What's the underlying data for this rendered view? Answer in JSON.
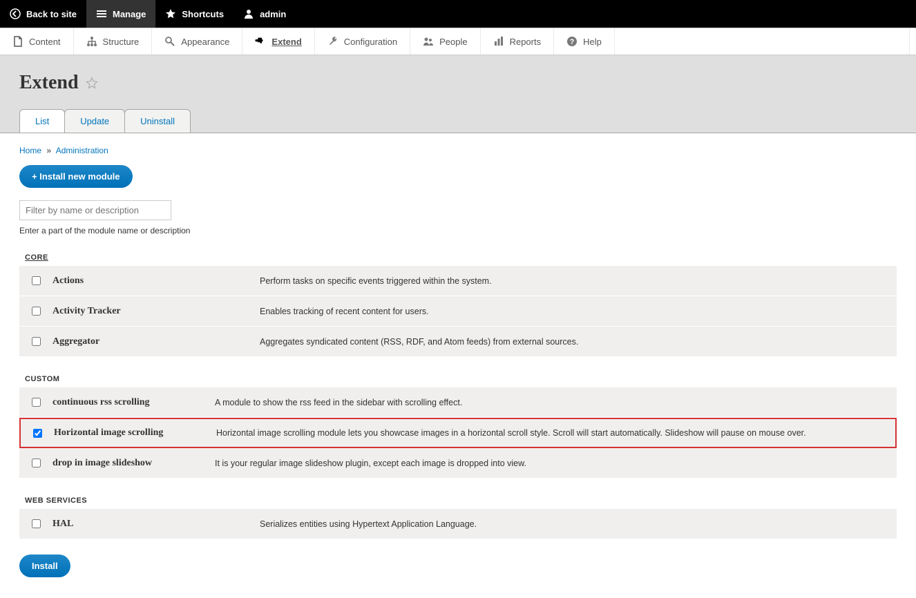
{
  "toolbar_black": {
    "back": "Back to site",
    "manage": "Manage",
    "shortcuts": "Shortcuts",
    "admin": "admin"
  },
  "toolbar_white": {
    "content": "Content",
    "structure": "Structure",
    "appearance": "Appearance",
    "extend": "Extend",
    "configuration": "Configuration",
    "people": "People",
    "reports": "Reports",
    "help": "Help"
  },
  "page": {
    "title": "Extend"
  },
  "tabs": {
    "list": "List",
    "update": "Update",
    "uninstall": "Uninstall"
  },
  "breadcrumb": {
    "home": "Home",
    "administration": "Administration"
  },
  "buttons": {
    "install_new": "+ Install new module",
    "install": "Install"
  },
  "filter": {
    "placeholder": "Filter by name or description",
    "help": "Enter a part of the module name or description"
  },
  "groups": {
    "core": "CORE",
    "custom": "CUSTOM",
    "web_services": "WEB SERVICES"
  },
  "modules": {
    "core": [
      {
        "name": "Actions",
        "desc": "Perform tasks on specific events triggered within the system."
      },
      {
        "name": "Activity Tracker",
        "desc": "Enables tracking of recent content for users."
      },
      {
        "name": "Aggregator",
        "desc": "Aggregates syndicated content (RSS, RDF, and Atom feeds) from external sources."
      }
    ],
    "custom": [
      {
        "name": "continuous rss scrolling",
        "desc": "A module to show the rss feed in the sidebar with scrolling effect."
      },
      {
        "name": "Horizontal image scrolling",
        "desc": "Horizontal image scrolling module lets you showcase images in a horizontal scroll style. Scroll will start automatically. Slideshow will pause on mouse over.",
        "checked": true,
        "highlight": true
      },
      {
        "name": "drop in image slideshow",
        "desc": "It is your regular image slideshow plugin, except each image is dropped into view."
      }
    ],
    "web_services": [
      {
        "name": "HAL",
        "desc": "Serializes entities using Hypertext Application Language."
      }
    ]
  }
}
